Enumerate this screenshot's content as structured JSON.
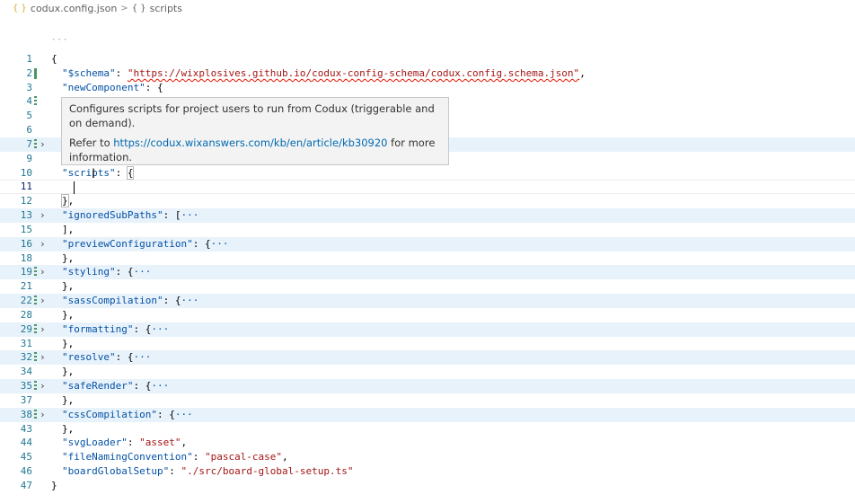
{
  "breadcrumb": {
    "file": "codux.config.json",
    "separator": ">",
    "symbol": "scripts"
  },
  "editor": {
    "ellipsis": "···",
    "lines": [
      {
        "n": "1",
        "t": "{"
      },
      {
        "n": "2"
      },
      {
        "n": "3"
      },
      {
        "n": "4"
      },
      {
        "n": "5"
      },
      {
        "n": "6"
      },
      {
        "n": "7"
      },
      {
        "n": "9"
      },
      {
        "n": "10"
      },
      {
        "n": "11"
      },
      {
        "n": "12"
      },
      {
        "n": "13"
      },
      {
        "n": "15",
        "t": "],"
      },
      {
        "n": "16"
      },
      {
        "n": "18",
        "t": "},"
      },
      {
        "n": "19"
      },
      {
        "n": "21",
        "t": "},"
      },
      {
        "n": "22"
      },
      {
        "n": "28",
        "t": "},"
      },
      {
        "n": "29"
      },
      {
        "n": "31",
        "t": "},"
      },
      {
        "n": "32"
      },
      {
        "n": "34",
        "t": "},"
      },
      {
        "n": "35"
      },
      {
        "n": "37",
        "t": "},"
      },
      {
        "n": "38"
      },
      {
        "n": "43",
        "t": "},"
      },
      {
        "n": "44"
      },
      {
        "n": "45"
      },
      {
        "n": "46"
      },
      {
        "n": "47",
        "t": "}"
      }
    ],
    "schema_key": "\"$schema\"",
    "schema_value": "\"https://wixplosives.github.io/codux-config-schema/codux.config.schema.json\"",
    "newComponent_key": "\"newComponent\"",
    "scripts_key": "\"scripts\"",
    "ignoredSubPaths_key": "\"ignoredSubPaths\"",
    "previewConfiguration_key": "\"previewConfiguration\"",
    "styling_key": "\"styling\"",
    "sassCompilation_key": "\"sassCompilation\"",
    "formatting_key": "\"formatting\"",
    "resolve_key": "\"resolve\"",
    "safeRender_key": "\"safeRender\"",
    "cssCompilation_key": "\"cssCompilation\"",
    "svgLoader_key": "\"svgLoader\"",
    "svgLoader_value": "\"asset\"",
    "fileNamingConvention_key": "\"fileNamingConvention\"",
    "fileNamingConvention_value": "\"pascal-case\"",
    "boardGlobalSetup_key": "\"boardGlobalSetup\"",
    "boardGlobalSetup_value": "\"./src/board-global-setup.ts\"",
    "fold_placeholder": "···"
  },
  "tooltip": {
    "description": "Configures scripts for project users to run from Codux (triggerable and on demand).",
    "refer_prefix": "Refer to ",
    "link": "https://codux.wixanswers.com/kb/en/article/kb30920",
    "refer_suffix": " for more information."
  },
  "colors": {
    "key": "#0451a5",
    "string": "#a31515",
    "line_number": "#237893",
    "fold_highlight": "#e8f2fb",
    "gutter_modified": "#48985d",
    "link": "#006ab1"
  }
}
